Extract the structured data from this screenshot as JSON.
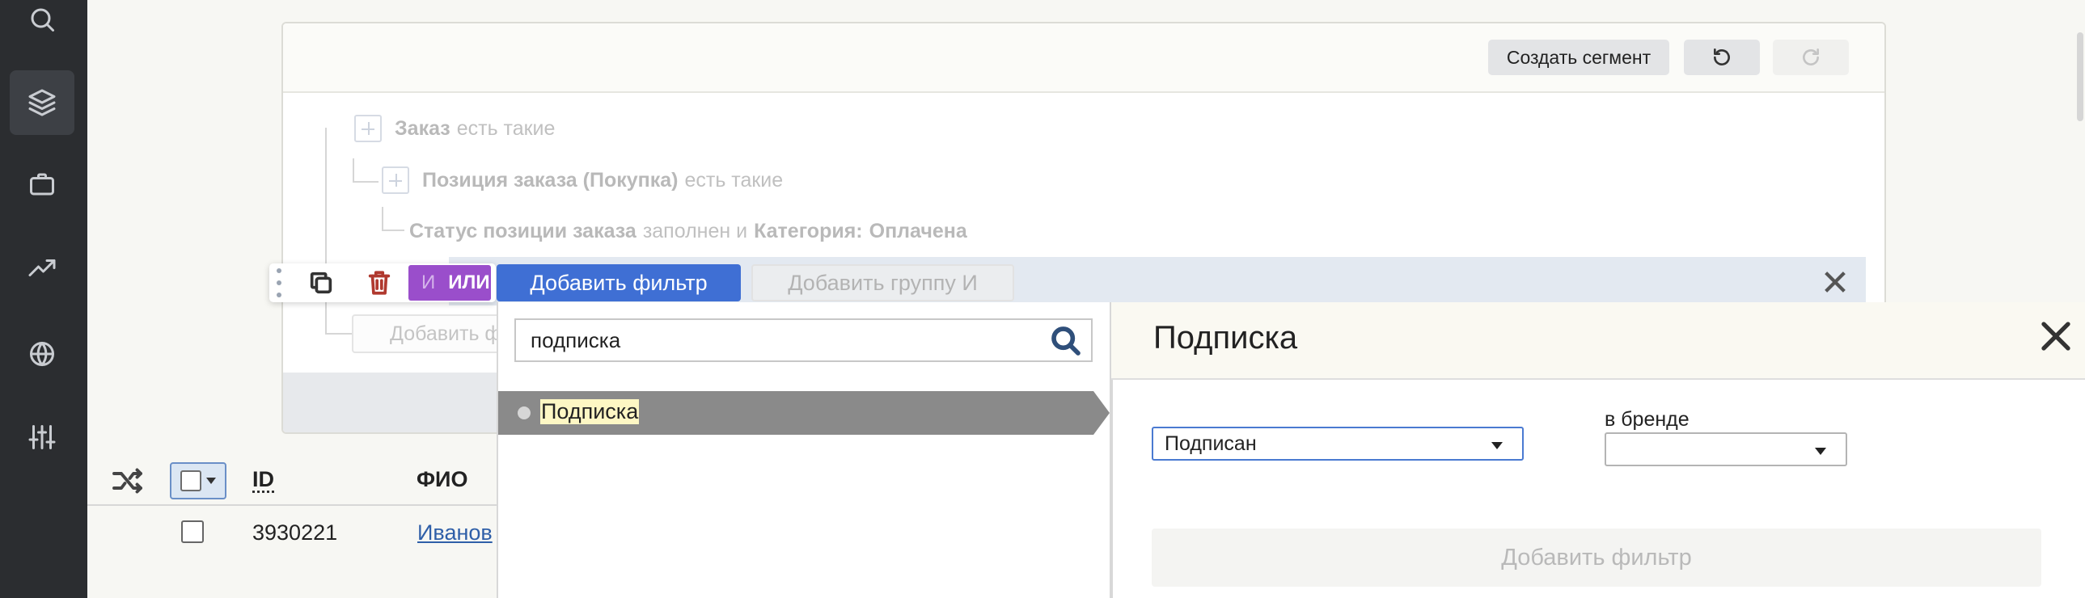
{
  "sidebar": {
    "items": [
      {
        "icon": "search-icon"
      },
      {
        "icon": "layers-icon",
        "active": true
      },
      {
        "icon": "briefcase-icon"
      },
      {
        "icon": "trending-icon"
      },
      {
        "icon": "globe-icon"
      },
      {
        "icon": "sliders-icon"
      }
    ]
  },
  "card": {
    "create_segment": "Создать сегмент",
    "undo_icon": "undo-icon",
    "redo_icon": "redo-icon"
  },
  "tree": {
    "row1": {
      "bold": "Заказ",
      "rest": "есть такие"
    },
    "row2": {
      "bold": "Позиция заказа (Покупка)",
      "rest": "есть такие"
    },
    "row3": {
      "bold1": "Статус позиции заказа",
      "mid": "заполнен и",
      "bold2": "Категория:",
      "bold3": "Оплачена"
    },
    "add_filter_ghost": "Добавить ф"
  },
  "group_bar": {
    "and_label": "И",
    "or_label": "ИЛИ",
    "add_filter": "Добавить фильтр",
    "add_group": "Добавить группу И"
  },
  "table": {
    "col_id": "ID",
    "col_fio": "ФИО",
    "rows": [
      {
        "id": "3930221",
        "fio": "Иванов"
      }
    ]
  },
  "search": {
    "value": "подписка",
    "results": [
      "Подписка"
    ]
  },
  "detail": {
    "title": "Подписка",
    "status_value": "Подписан",
    "brand_label": "в бренде",
    "brand_value": "",
    "add_filter": "Добавить фильтр"
  },
  "colors": {
    "sidebar_bg": "#2b2d30",
    "primary": "#3f6fd4",
    "and_or": "#9a4ecb",
    "delete": "#b0392f"
  }
}
